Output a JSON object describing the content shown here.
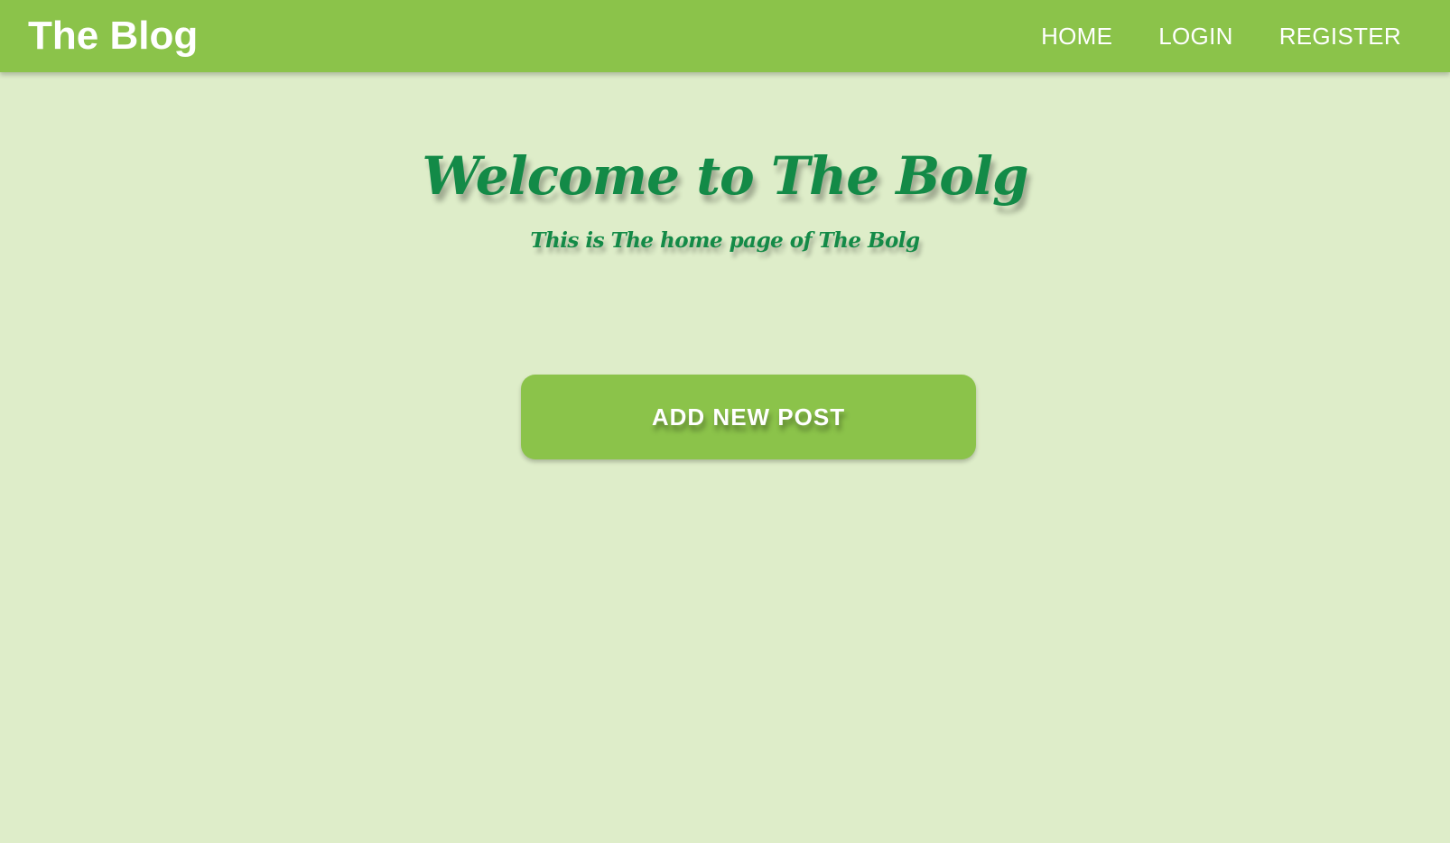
{
  "navbar": {
    "brand": "The Blog",
    "links": [
      {
        "label": "HOME"
      },
      {
        "label": "LOGIN"
      },
      {
        "label": "REGISTER"
      }
    ]
  },
  "hero": {
    "title": "Welcome to The Bolg",
    "subtitle": "This is The home page of The Bolg"
  },
  "actions": {
    "add_post_label": "ADD NEW POST"
  },
  "colors": {
    "primary": "#8bc34a",
    "background": "#deedc9",
    "heading": "#138a47",
    "text_on_primary": "#ffffff"
  }
}
